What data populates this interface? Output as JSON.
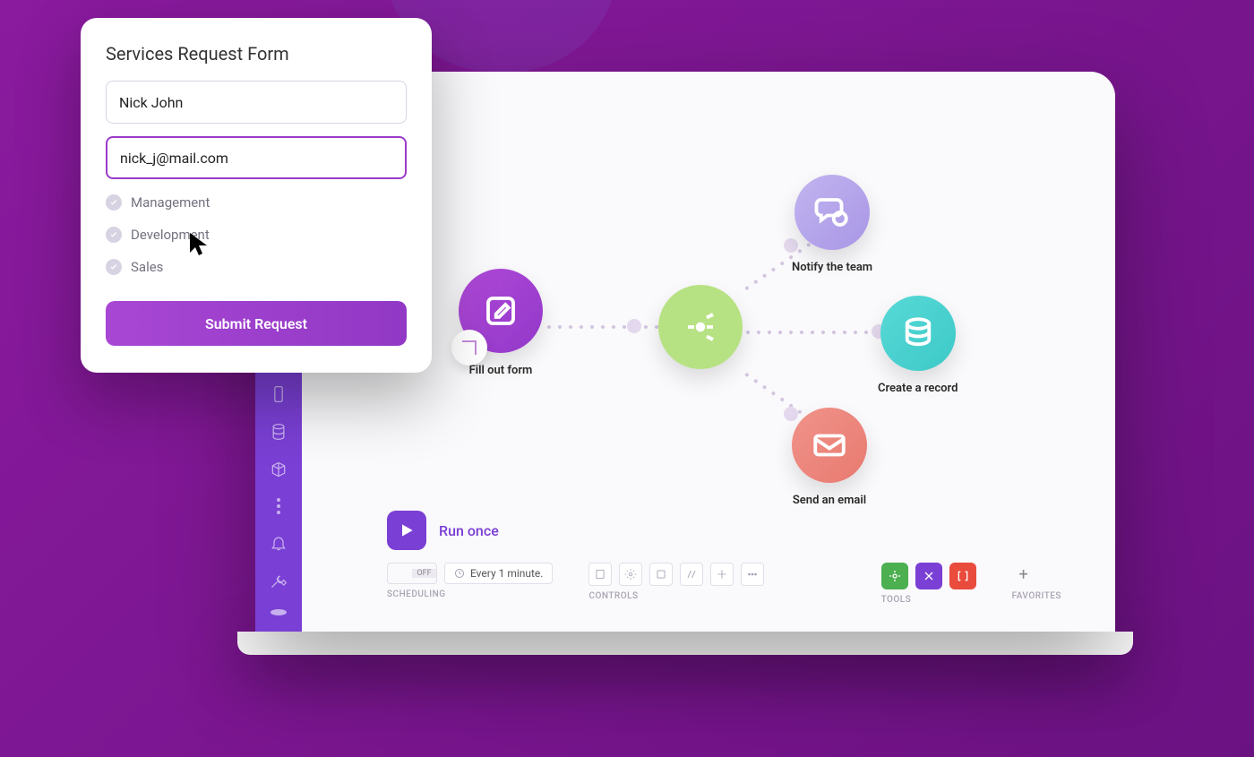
{
  "form": {
    "title": "Services Request Form",
    "name_value": "Nick John",
    "email_value": "nick_j@mail.com",
    "options": [
      "Management",
      "Development",
      "Sales"
    ],
    "submit_label": "Submit Request"
  },
  "nodes": {
    "form_label": "Fill out form",
    "notify_label": "Notify the team",
    "record_label": "Create a record",
    "email_label": "Send an email"
  },
  "run": {
    "label": "Run once"
  },
  "toolbar": {
    "scheduling_label": "SCHEDULING",
    "controls_label": "CONTROLS",
    "tools_label": "TOOLS",
    "favorites_label": "FAVORITES",
    "off": "OFF",
    "interval": "Every 1 minute."
  },
  "colors": {
    "tool_green": "#4caf50",
    "tool_purple": "#7a3fd4",
    "tool_red": "#e94b3c"
  }
}
